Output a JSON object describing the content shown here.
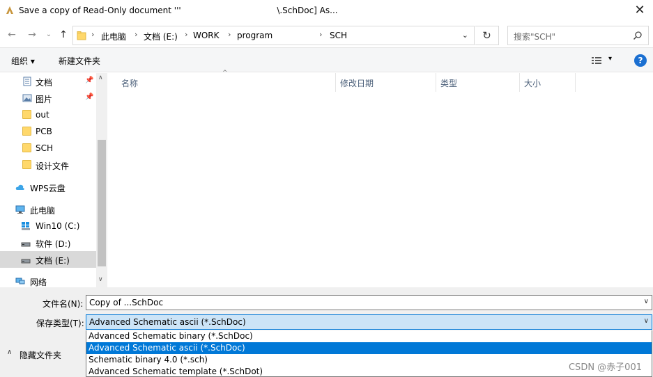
{
  "window": {
    "title_prefix": "Save a copy of Read-Only document '''",
    "title_suffix": "\\.SchDoc] As...",
    "close_label": "✕"
  },
  "nav": {
    "back": "←",
    "forward": "→",
    "history": "⌄",
    "up": "↑",
    "breadcrumbs": [
      "此电脑",
      "文档 (E:)",
      "WORK",
      "program",
      "SCH"
    ],
    "refresh": "↻",
    "search_placeholder": "搜索\"SCH\""
  },
  "toolbar": {
    "organize": "组织 ▾",
    "new_folder": "新建文件夹",
    "view_dropdown": "▾",
    "help": "?"
  },
  "sidebar": {
    "items": [
      {
        "label": "文档",
        "icon": "documents-icon",
        "pinned": true
      },
      {
        "label": "图片",
        "icon": "pictures-icon",
        "pinned": true
      },
      {
        "label": "out",
        "icon": "folder-icon"
      },
      {
        "label": "PCB",
        "icon": "folder-icon"
      },
      {
        "label": "SCH",
        "icon": "folder-icon"
      },
      {
        "label": "设计文件",
        "icon": "folder-icon"
      },
      {
        "label": "WPS云盘",
        "icon": "cloud-icon"
      },
      {
        "label": "此电脑",
        "icon": "computer-icon"
      },
      {
        "label": "Win10 (C:)",
        "icon": "windows-drive-icon"
      },
      {
        "label": "软件 (D:)",
        "icon": "drive-icon"
      },
      {
        "label": "文档 (E:)",
        "icon": "drive-icon",
        "selected": true
      },
      {
        "label": "网络",
        "icon": "network-icon"
      }
    ],
    "pin_glyph": "📌"
  },
  "columns": [
    "名称",
    "修改日期",
    "类型",
    "大小"
  ],
  "form": {
    "filename_label": "文件名(N):",
    "filename_value": "Copy of ...SchDoc",
    "filetype_label": "保存类型(T):",
    "filetype_value": "Advanced Schematic ascii (*.SchDoc)",
    "options": [
      {
        "label": "Advanced Schematic binary (*.SchDoc)",
        "selected": false
      },
      {
        "label": "Advanced Schematic ascii (*.SchDoc)",
        "selected": true
      },
      {
        "label": "Schematic binary 4.0 (*.sch)",
        "selected": false
      },
      {
        "label": "Advanced Schematic template (*.SchDot)",
        "selected": false
      }
    ],
    "hide_folders": "隐藏文件夹",
    "hide_arrow": "∧"
  },
  "watermark": "CSDN @赤子001",
  "colors": {
    "selection": "#0078d7",
    "selection_light": "#cce4f7",
    "folder": "#ffd86b",
    "help": "#1a6fd1"
  }
}
